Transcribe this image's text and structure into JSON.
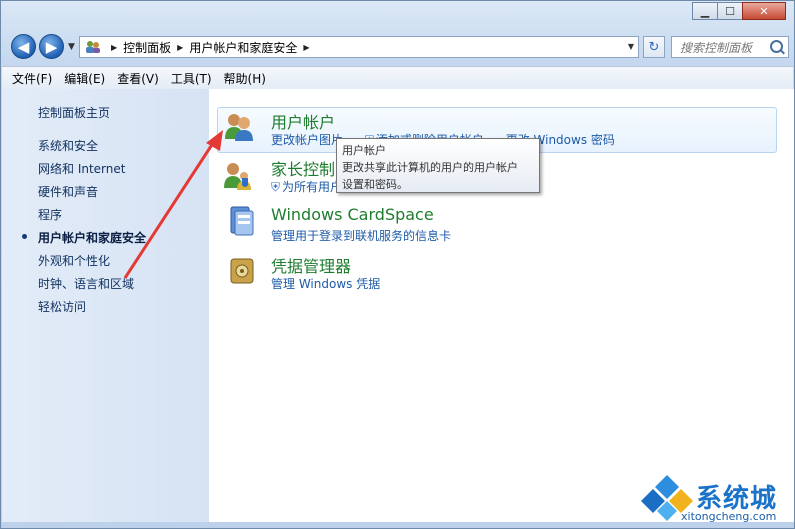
{
  "window": {
    "minimize_glyph": "▁",
    "maximize_glyph": "☐",
    "close_glyph": "✕"
  },
  "navigation": {
    "back_glyph": "◀",
    "forward_glyph": "▶",
    "breadcrumb": [
      "控制面板",
      "用户帐户和家庭安全"
    ],
    "search_placeholder": "搜索控制面板",
    "refresh_glyph": "↻"
  },
  "menu": [
    "文件(F)",
    "编辑(E)",
    "查看(V)",
    "工具(T)",
    "帮助(H)"
  ],
  "sidebar": {
    "home": "控制面板主页",
    "items": [
      "系统和安全",
      "网络和 Internet",
      "硬件和声音",
      "程序",
      "用户帐户和家庭安全",
      "外观和个性化",
      "时钟、语言和区域",
      "轻松访问"
    ],
    "active_index": 4
  },
  "categories": [
    {
      "title": "用户帐户",
      "links": [
        "更改帐户图片",
        "添加或删除用户帐户",
        "更改 Windows 密码"
      ],
      "icon": "users-icon"
    },
    {
      "title": "家长控制",
      "links": [
        "为所有用户设置家长控制"
      ],
      "icon": "parental-control-icon"
    },
    {
      "title": "Windows CardSpace",
      "links": [
        "管理用于登录到联机服务的信息卡"
      ],
      "icon": "cardspace-icon"
    },
    {
      "title": "凭据管理器",
      "links": [
        "管理 Windows 凭据"
      ],
      "icon": "credential-manager-icon"
    }
  ],
  "tooltip": {
    "title": "用户帐户",
    "line1": "更改共享此计算机的用户的用户帐户",
    "line2": "设置和密码。"
  },
  "watermark": {
    "text": "系统城",
    "domain": "xitongcheng.com"
  },
  "colors": {
    "category_title": "#1e7d2e",
    "link": "#1d5ba8",
    "annotation_arrow": "#e53935"
  }
}
